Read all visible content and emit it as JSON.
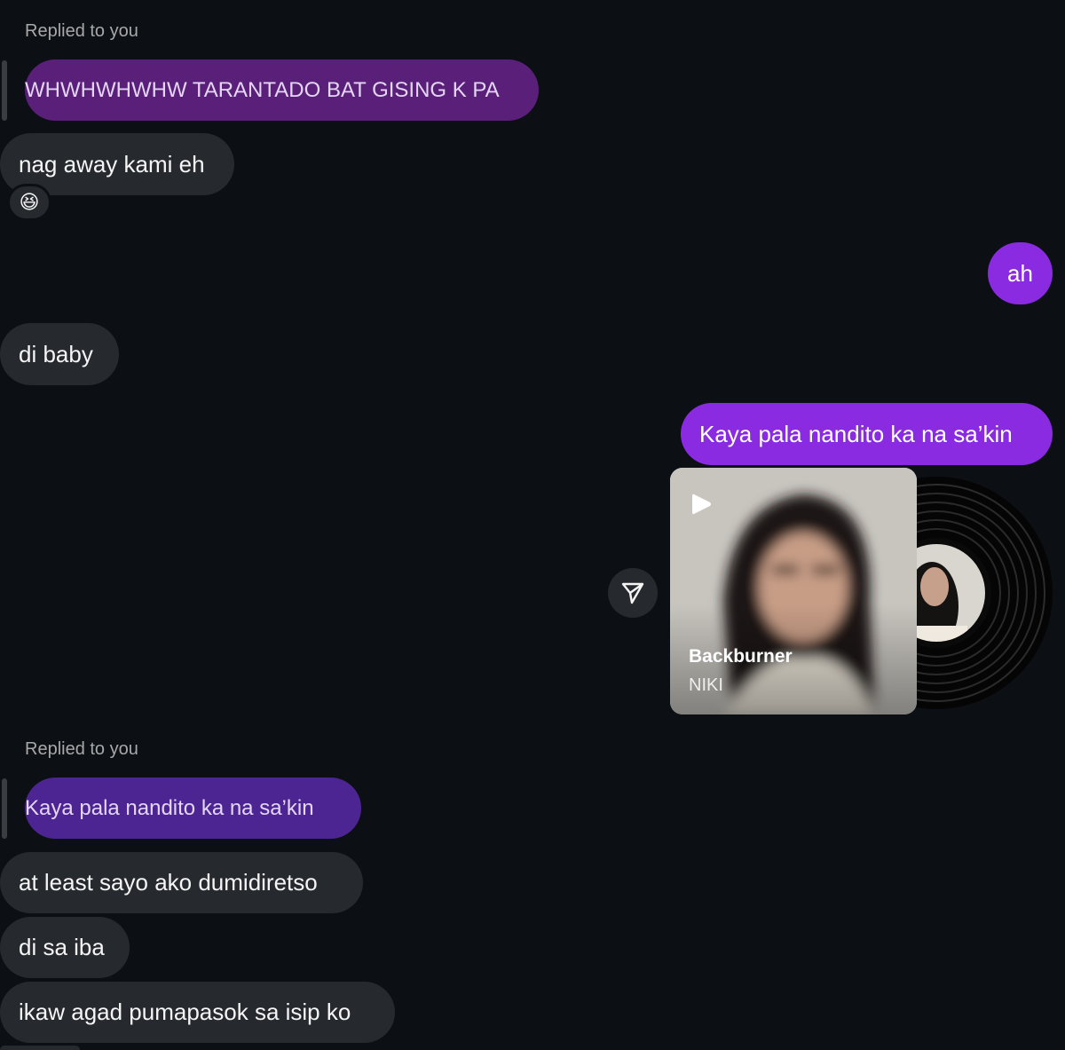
{
  "thread": {
    "reply_label_1": "Replied to you",
    "quoted_1": "WHWHWHWHW TARANTADO BAT GISING K PA",
    "msg_nag_away": "nag away kami eh",
    "reaction_emoji": "😆",
    "msg_ah": "ah",
    "msg_di_baby": "di baby",
    "msg_kaya_pala": "Kaya pala nandito ka na sa’kin",
    "music": {
      "title": "Backburner",
      "artist": "NIKI"
    },
    "reply_label_2": "Replied to you",
    "quoted_2": "Kaya pala nandito ka na sa’kin",
    "msg_at_least": "at least sayo ako dumidiretso",
    "msg_di_sa_iba": "di sa iba",
    "msg_ikaw_agad": "ikaw agad pumapasok sa isip ko"
  },
  "colors": {
    "background": "#0c1014",
    "incoming_bubble": "#26292e",
    "outgoing_bubble": "#8a2be2",
    "quoted_bubble_1": "#5a1f78",
    "quoted_bubble_2": "#4c2592",
    "meta_text": "#a8a8a8"
  },
  "icons": [
    "reply-bar",
    "reaction-emoji",
    "share-icon",
    "play-icon",
    "vinyl-record"
  ]
}
